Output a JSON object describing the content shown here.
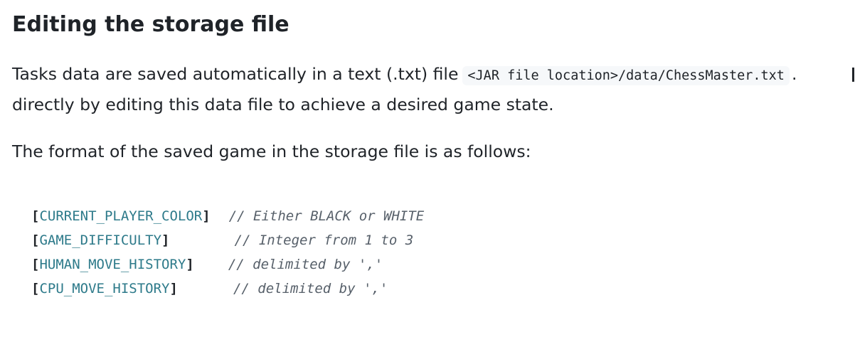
{
  "heading": "Editing the storage file",
  "paragraph1": {
    "line1_text": "Tasks data are saved automatically in a text (.txt) file",
    "line1_code": "<JAR file location>/data/ChessMaster.txt",
    "line1_trail": ".",
    "line2_text": "directly by editing this data file to achieve a desired game state."
  },
  "paragraph2": "The format of the saved game in the storage file is as follows:",
  "code_block": {
    "rows": [
      {
        "open": "[",
        "field": "CURRENT_PLAYER_COLOR",
        "close": "]",
        "comment": "// Either BLACK or WHITE"
      },
      {
        "open": "[",
        "field": "GAME_DIFFICULTY",
        "close": "]",
        "comment": "// Integer from 1 to 3"
      },
      {
        "open": "[",
        "field": "HUMAN_MOVE_HISTORY",
        "close": "]",
        "comment": "// delimited by ','"
      },
      {
        "open": "[",
        "field": "CPU_MOVE_HISTORY",
        "close": "]",
        "comment": "// delimited by ','"
      }
    ]
  },
  "colors": {
    "text": "#1f2328",
    "field": "#2d7a8a",
    "comment": "#57606a",
    "code_bg": "#f6f8fa"
  }
}
